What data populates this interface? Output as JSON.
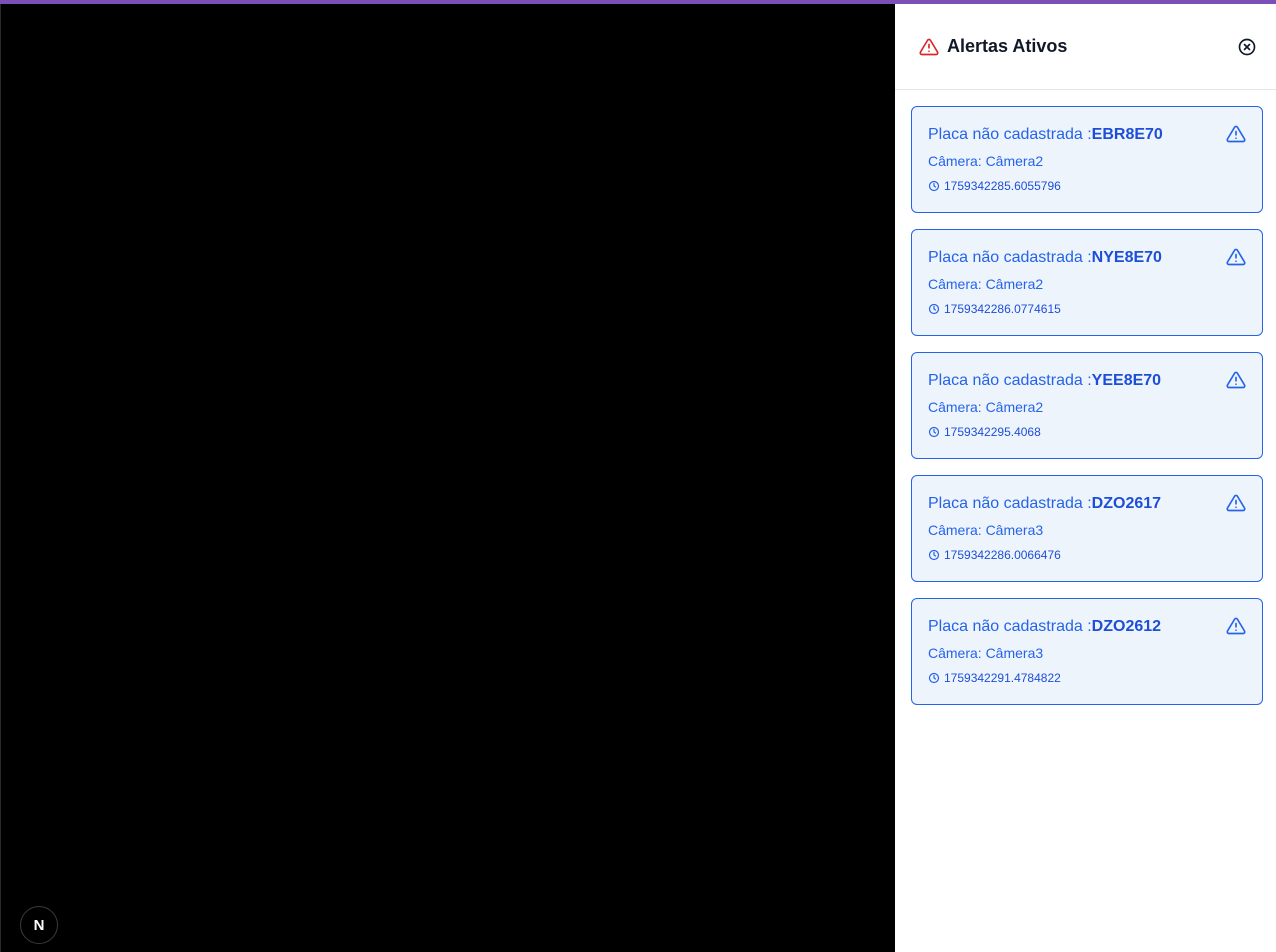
{
  "panel": {
    "title": "Alertas Ativos"
  },
  "badge": {
    "label": "N"
  },
  "alerts": [
    {
      "prefix": "Placa não cadastrada :",
      "plate": "EBR8E70",
      "camera": "Câmera: Câmera2",
      "timestamp": "1759342285.6055796"
    },
    {
      "prefix": "Placa não cadastrada :",
      "plate": "NYE8E70",
      "camera": "Câmera: Câmera2",
      "timestamp": "1759342286.0774615"
    },
    {
      "prefix": "Placa não cadastrada :",
      "plate": "YEE8E70",
      "camera": "Câmera: Câmera2",
      "timestamp": "1759342295.4068"
    },
    {
      "prefix": "Placa não cadastrada :",
      "plate": "DZO2617",
      "camera": "Câmera: Câmera3",
      "timestamp": "1759342286.0066476"
    },
    {
      "prefix": "Placa não cadastrada :",
      "plate": "DZO2612",
      "camera": "Câmera: Câmera3",
      "timestamp": "1759342291.4784822"
    }
  ],
  "colors": {
    "accent_bar": "#7b4fb8",
    "alert_red": "#dc2626",
    "card_blue": "#2563eb",
    "card_bg": "#eef4fb"
  },
  "icons": {
    "header": "warning-triangle-icon",
    "close": "close-circle-icon",
    "card": "warning-triangle-icon",
    "time": "clock-icon"
  }
}
